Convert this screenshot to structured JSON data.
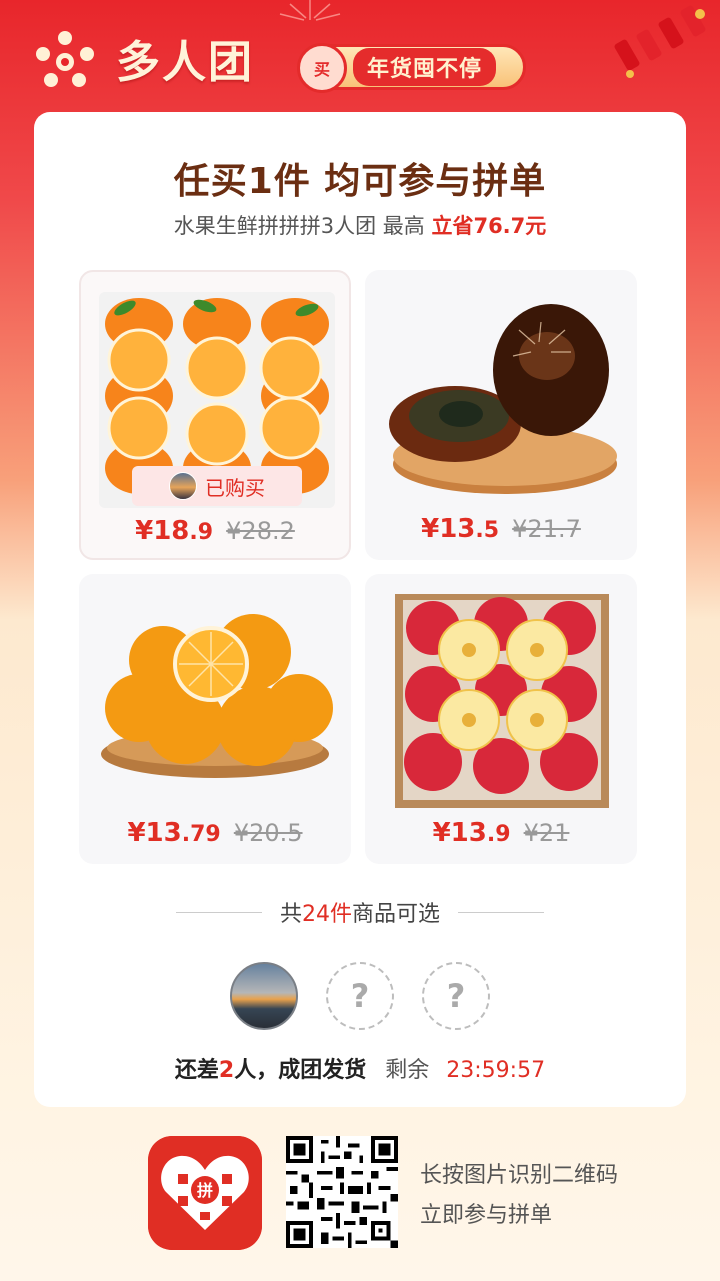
{
  "header": {
    "brand_title": "多人团",
    "promo_badge": "买",
    "promo_text": "年货囤不停"
  },
  "card": {
    "title": "任买1件 均可参与拼单",
    "subtitle_prefix": "水果生鲜拼拼拼3人团 最高",
    "subtitle_save": "立省76.7元"
  },
  "products": [
    {
      "image": "mandarin-oranges-box-image",
      "price_int": "¥18",
      "price_dec": ".9",
      "orig_price": "¥28.2",
      "bought_label": "已购买"
    },
    {
      "image": "century-eggs-image",
      "price_int": "¥13",
      "price_dec": ".5",
      "orig_price": "¥21.7"
    },
    {
      "image": "navel-oranges-basket-image",
      "price_int": "¥13",
      "price_dec": ".79",
      "orig_price": "¥20.5"
    },
    {
      "image": "apples-box-image",
      "price_int": "¥13",
      "price_dec": ".9",
      "orig_price": "¥21"
    }
  ],
  "selection": {
    "prefix": "共",
    "count": "24件",
    "suffix": "商品可选"
  },
  "group": {
    "empty_slot_glyph": "?",
    "status_a": "还差",
    "status_count": "2",
    "status_b": "人，成团发货",
    "remaining_label": "剩余",
    "timer": "23:59:57"
  },
  "footer": {
    "line1": "长按图片识别二维码",
    "line2": "立即参与拼单"
  },
  "colors": {
    "accent": "#e02e24",
    "title_brown": "#6b2e12"
  }
}
